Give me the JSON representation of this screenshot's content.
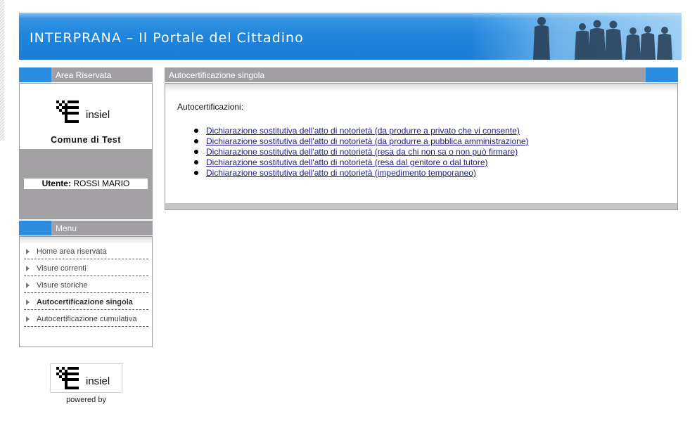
{
  "header": {
    "title": "INTERPRANA – Il Portale del Cittadino"
  },
  "area_riservata": {
    "heading": "Area Riservata",
    "logo_text": "insiel",
    "comune": "Comune di Test",
    "user_label": "Utente:",
    "user_name": "ROSSI MARIO"
  },
  "menu": {
    "heading": "Menu",
    "items": [
      {
        "label": "Home area riservata",
        "active": false
      },
      {
        "label": "Visure correnti",
        "active": false
      },
      {
        "label": "Visure storiche",
        "active": false
      },
      {
        "label": "Autocertificazione singola",
        "active": true
      },
      {
        "label": "Autocertificazione cumulativa",
        "active": false
      }
    ]
  },
  "powered": {
    "logo_text": "insiel",
    "caption": "powered by"
  },
  "main": {
    "heading": "Autocertificazione singola",
    "intro": "Autocertificazioni:",
    "links": [
      "Dichiarazione sostitutiva dell'atto di notorietà (da produrre a privato che vi consente)",
      "Dichiarazione sostitutiva dell'atto di notorietà (da produrre a pubblica amministrazione)",
      "Dichiarazione sostitutiva dell'atto di notorietà (resa da chi non sa o non può firmare)",
      "Dichiarazione sostitutiva dell'atto di notorietà (resa dal genitore o dal tutore)",
      "Dichiarazione sostitutiva dell'atto di notorietà (impedimento temporaneo)"
    ]
  },
  "colors": {
    "banner_blue": "#1f86dd",
    "accent_blue": "#2b8de0",
    "panel_gray": "#a19fa3",
    "link": "#1c1c8c"
  },
  "icons": {
    "menu_bullet": "triangle-right-icon",
    "logo": "insiel-logo-icon"
  }
}
